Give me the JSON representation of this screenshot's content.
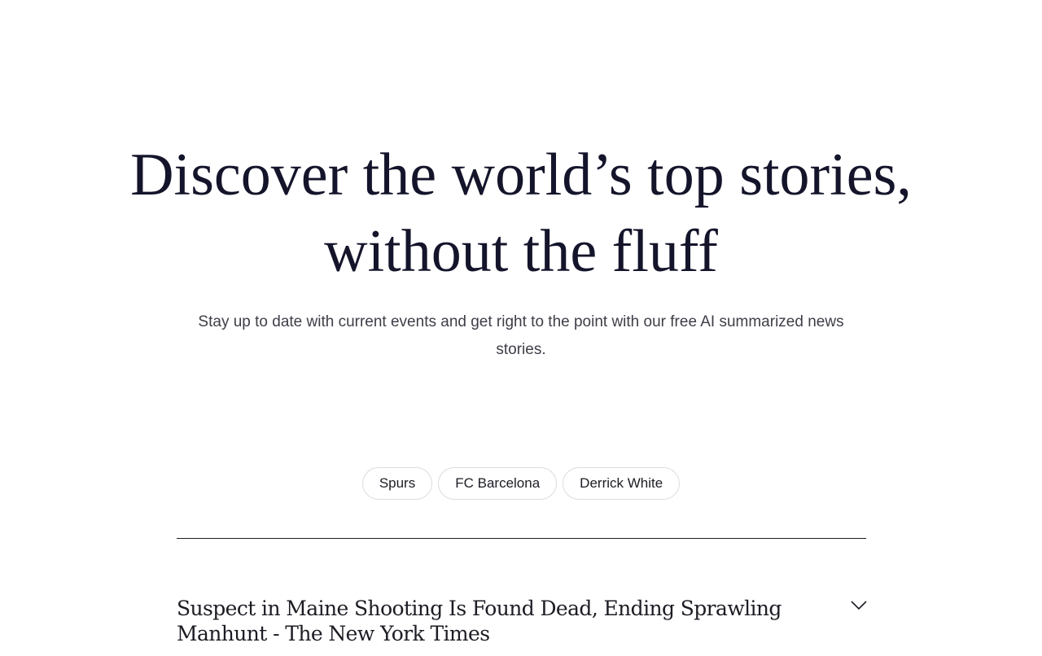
{
  "hero": {
    "title_line1": "Discover the world’s top stories,",
    "title_line2": "without the fluff",
    "subtitle": "Stay up to date with current events and get right to the point with our free AI summarized news stories."
  },
  "topics": [
    {
      "label": "Spurs"
    },
    {
      "label": "FC Barcelona"
    },
    {
      "label": "Derrick White"
    }
  ],
  "stories": [
    {
      "headline": "Suspect in Maine Shooting Is Found Dead, Ending Sprawling Manhunt - The New York Times",
      "toggle_icon": "chevron-down-icon"
    }
  ]
}
